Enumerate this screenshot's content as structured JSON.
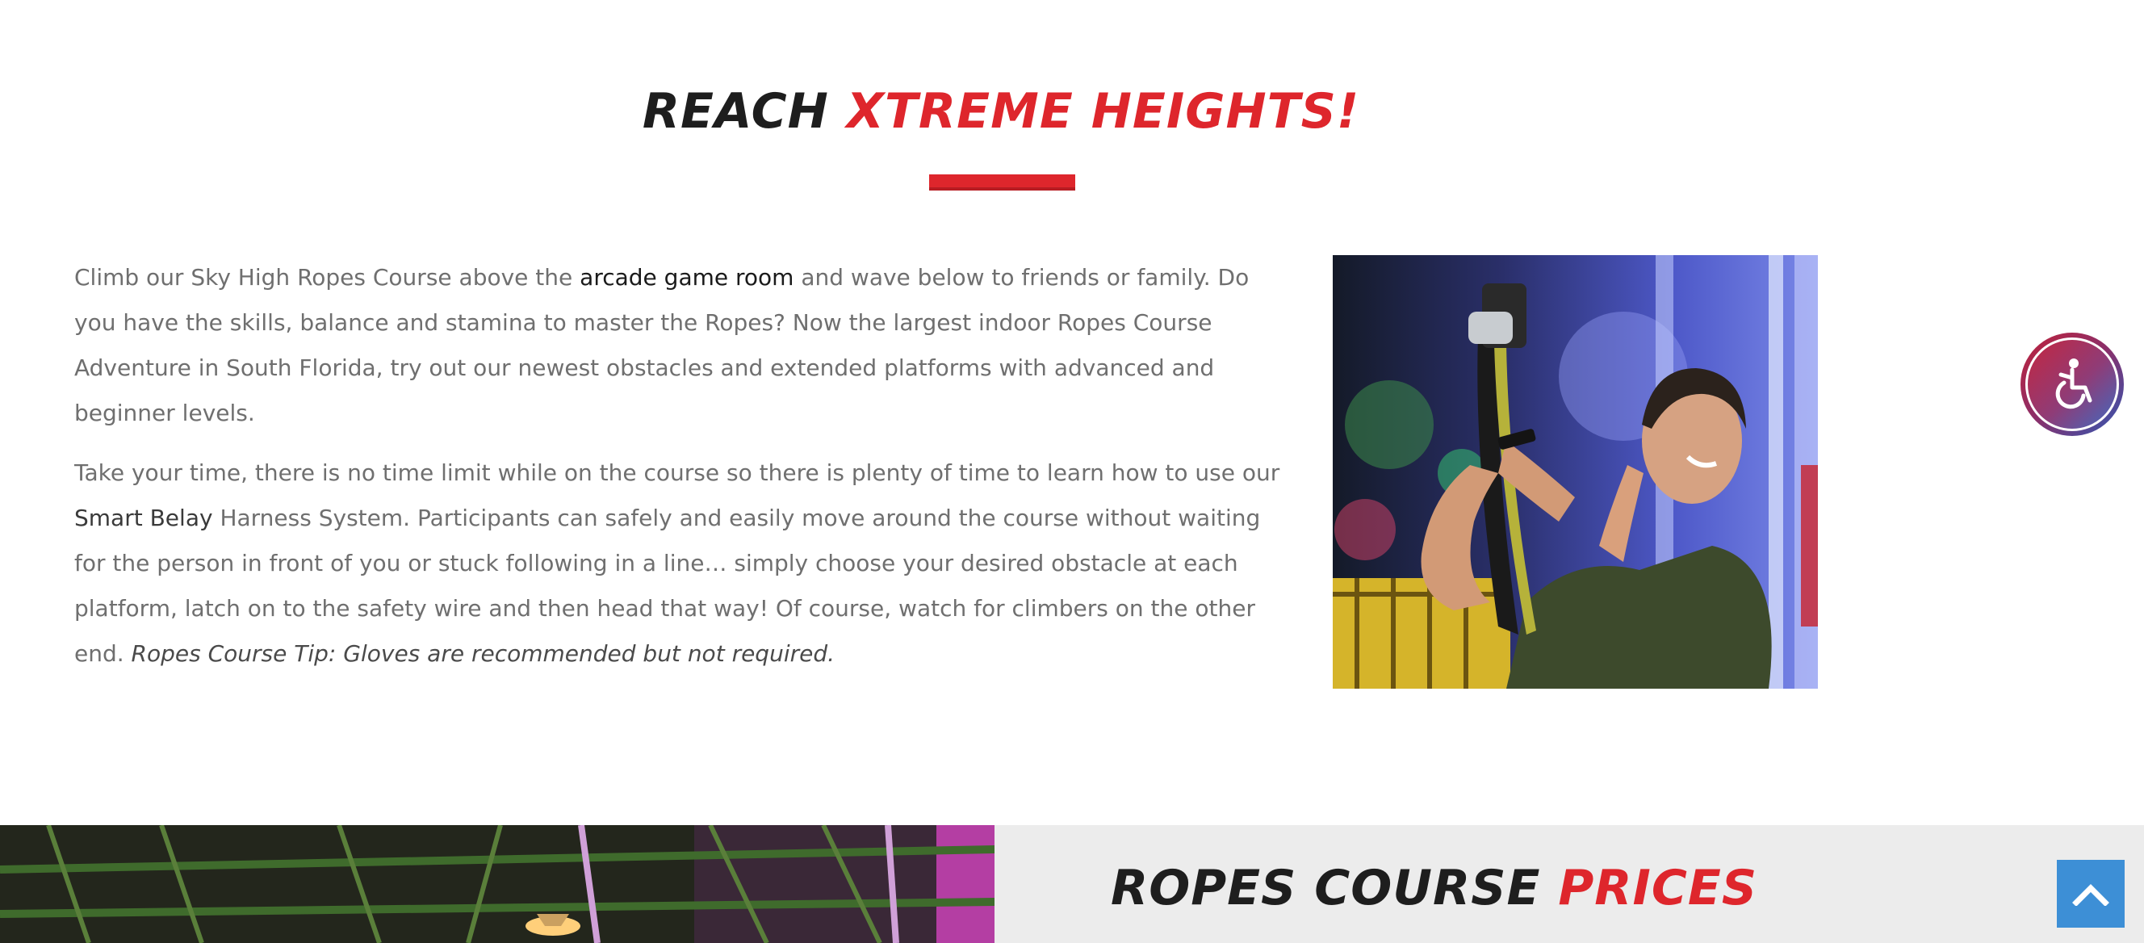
{
  "hero": {
    "title_main": "REACH ",
    "title_accent": "XTREME HEIGHTS!"
  },
  "intro": {
    "p1_before": "Climb our Sky High Ropes Course above the ",
    "p1_link": "arcade game room",
    "p1_after": " and wave below to friends or family.  Do you have the skills, balance and stamina to master the Ropes? Now the largest indoor Ropes Course Adventure in South Florida, try out our newest obstacles and extended platforms with advanced and beginner levels.",
    "p2_before": "Take your time, there is no time limit while on the course so there is plenty of time to learn how to use our ",
    "p2_strong": "Smart Belay",
    "p2_after": " Harness System.  Participants can safely and easily move around the course without waiting for the person in front of you or stuck following in a line… simply choose your desired obstacle at each platform, latch on to the safety wire and then head that way!  Of course, watch for climbers on the other end. ",
    "p2_tip": "Ropes Course Tip: Gloves are recommended but not required."
  },
  "prices": {
    "title_main": "ROPES COURSE ",
    "title_accent": "PRICES"
  },
  "icons": {
    "accessibility": "wheelchair-icon",
    "back_to_top": "chevron-up-icon"
  },
  "colors": {
    "accent": "#de262c",
    "heading": "#1e1e1e",
    "body_text": "#6f6f6f",
    "back_to_top_bg": "#3d8fd6",
    "prices_bg": "#ececec"
  }
}
